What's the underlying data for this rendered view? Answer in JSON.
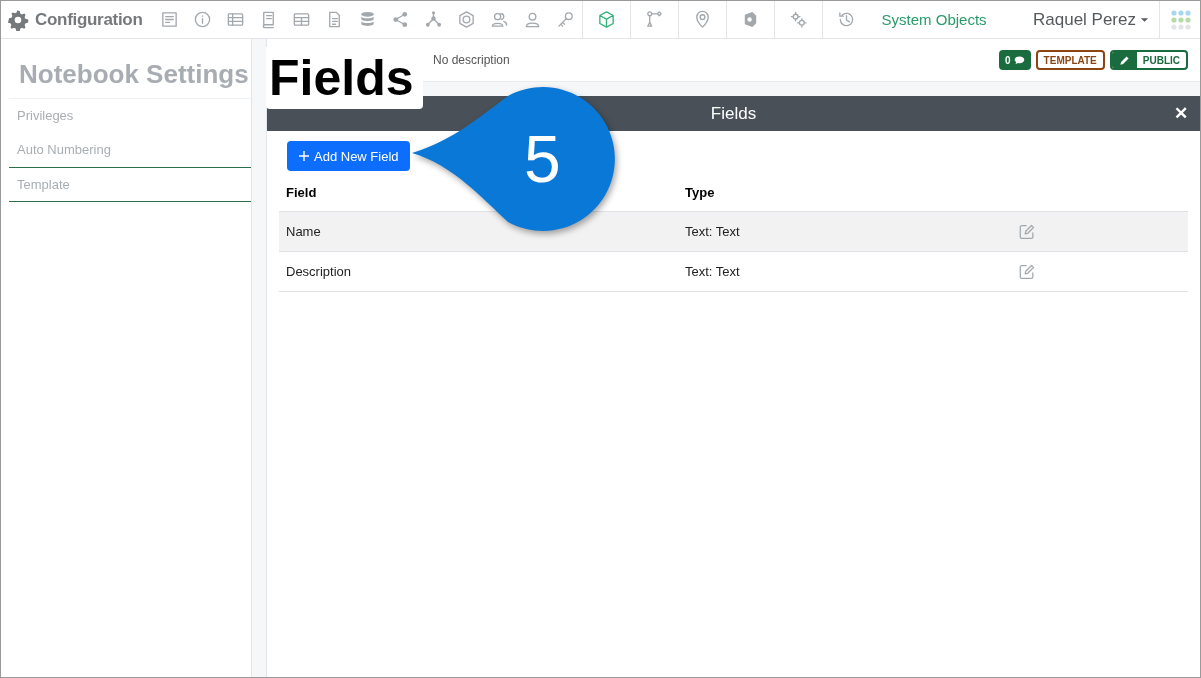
{
  "app": {
    "title": "Configuration"
  },
  "toolbar": [
    {
      "selected": false
    },
    {
      "selected": false
    },
    {
      "selected": false
    },
    {
      "selected": false
    },
    {
      "selected": false
    },
    {
      "selected": false
    },
    {
      "selected": false
    },
    {
      "selected": false
    },
    {
      "selected": false
    },
    {
      "selected": false
    },
    {
      "selected": false
    },
    {
      "selected": false
    },
    {
      "selected": false
    },
    {
      "selected": true
    },
    {
      "selected": false
    },
    {
      "selected": false
    },
    {
      "selected": false
    },
    {
      "selected": false
    },
    {
      "selected": false
    }
  ],
  "system_objects_link": "System Objects",
  "user_menu": "Raquel Perez",
  "sidebar": {
    "title": "Notebook Settings",
    "items": [
      {
        "label": "Privileges",
        "selected": false
      },
      {
        "label": "Auto Numbering",
        "selected": false
      },
      {
        "label": "Template",
        "selected": true
      }
    ]
  },
  "header": {
    "description": "No description",
    "comment_count": "0",
    "template_badge": "TEMPLATE",
    "visibility_badge": "PUBLIC"
  },
  "panel": {
    "title": "Fields",
    "close": "✕",
    "add_button": "Add New Field",
    "table": {
      "columns": [
        "Field",
        "Type"
      ],
      "rows": [
        {
          "field": "Name",
          "type": "Text: Text",
          "selected": true
        },
        {
          "field": "Description",
          "type": "Text: Text",
          "selected": false
        }
      ]
    }
  },
  "callout": {
    "label": "Fields",
    "step": "5"
  }
}
